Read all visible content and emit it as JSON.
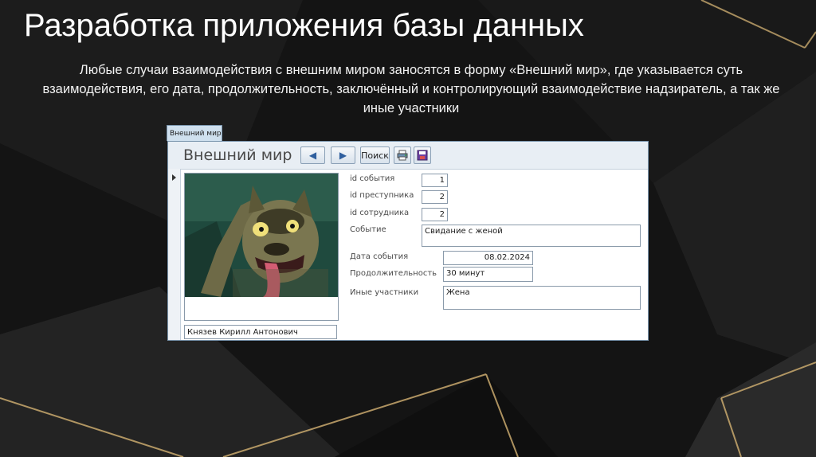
{
  "slide": {
    "title": "Разработка приложения базы данных",
    "body": "Любые случаи взаимодействия с внешним миром заносятся в форму «Внешний мир», где указывается суть взаимодействия, его дата, продолжительность, заключённый и контролирующий взаимодействие надзиратель, а так же иные участники"
  },
  "form": {
    "tab_label": "Внешний мир",
    "title": "Внешний мир",
    "buttons": {
      "prev": "◀",
      "next": "▶",
      "search": "Поиск"
    },
    "employee_name": "Князев Кирилл Антонович",
    "fields": {
      "event_id": {
        "label": "id события",
        "value": "1"
      },
      "criminal_id": {
        "label": "id преступника",
        "value": "2"
      },
      "employee_id": {
        "label": "id сотрудника",
        "value": "2"
      },
      "event": {
        "label": "Событие",
        "value": "Свидание с женой"
      },
      "event_date": {
        "label": "Дата события",
        "value": "08.02.2024"
      },
      "duration": {
        "label": "Продолжительность",
        "value": "30 минут"
      },
      "other_participants": {
        "label": "Иные участники",
        "value": "Жена"
      }
    }
  },
  "colors": {
    "accent": "#c9a96e",
    "form_border": "#7a95ad",
    "nav_arrow": "#2f5f9e"
  }
}
